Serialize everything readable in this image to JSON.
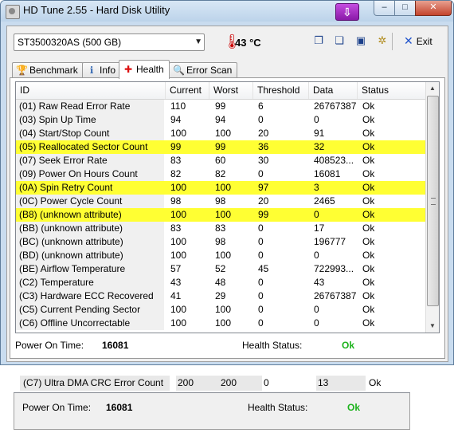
{
  "window": {
    "title": "HD Tune 2.55 - Hard Disk Utility",
    "controls": {
      "minimize": "–",
      "maximize": "□",
      "close": "✕"
    }
  },
  "toolbar": {
    "drive": "ST3500320AS (500 GB)",
    "temperature": "43 °C",
    "exit_label": "Exit"
  },
  "tabs": [
    {
      "label": "Benchmark",
      "icon": "trophy-icon",
      "active": false
    },
    {
      "label": "Info",
      "icon": "info-icon",
      "active": false
    },
    {
      "label": "Health",
      "icon": "health-cross-icon",
      "active": true
    },
    {
      "label": "Error Scan",
      "icon": "magnifier-icon",
      "active": false
    }
  ],
  "table": {
    "columns": [
      "ID",
      "Current",
      "Worst",
      "Threshold",
      "Data",
      "Status"
    ],
    "rows": [
      {
        "id": "(01) Raw Read Error Rate",
        "current": "110",
        "worst": "99",
        "threshold": "6",
        "data": "26767387",
        "status": "Ok",
        "highlight": false
      },
      {
        "id": "(03) Spin Up Time",
        "current": "94",
        "worst": "94",
        "threshold": "0",
        "data": "0",
        "status": "Ok",
        "highlight": false
      },
      {
        "id": "(04) Start/Stop Count",
        "current": "100",
        "worst": "100",
        "threshold": "20",
        "data": "91",
        "status": "Ok",
        "highlight": false
      },
      {
        "id": "(05) Reallocated Sector Count",
        "current": "99",
        "worst": "99",
        "threshold": "36",
        "data": "32",
        "status": "Ok",
        "highlight": true
      },
      {
        "id": "(07) Seek Error Rate",
        "current": "83",
        "worst": "60",
        "threshold": "30",
        "data": "408523...",
        "status": "Ok",
        "highlight": false
      },
      {
        "id": "(09) Power On Hours Count",
        "current": "82",
        "worst": "82",
        "threshold": "0",
        "data": "16081",
        "status": "Ok",
        "highlight": false
      },
      {
        "id": "(0A) Spin Retry Count",
        "current": "100",
        "worst": "100",
        "threshold": "97",
        "data": "3",
        "status": "Ok",
        "highlight": true
      },
      {
        "id": "(0C) Power Cycle Count",
        "current": "98",
        "worst": "98",
        "threshold": "20",
        "data": "2465",
        "status": "Ok",
        "highlight": false
      },
      {
        "id": "(B8) (unknown attribute)",
        "current": "100",
        "worst": "100",
        "threshold": "99",
        "data": "0",
        "status": "Ok",
        "highlight": true
      },
      {
        "id": "(BB) (unknown attribute)",
        "current": "83",
        "worst": "83",
        "threshold": "0",
        "data": "17",
        "status": "Ok",
        "highlight": false
      },
      {
        "id": "(BC) (unknown attribute)",
        "current": "100",
        "worst": "98",
        "threshold": "0",
        "data": "196777",
        "status": "Ok",
        "highlight": false
      },
      {
        "id": "(BD) (unknown attribute)",
        "current": "100",
        "worst": "100",
        "threshold": "0",
        "data": "0",
        "status": "Ok",
        "highlight": false
      },
      {
        "id": "(BE) Airflow Temperature",
        "current": "57",
        "worst": "52",
        "threshold": "45",
        "data": "722993...",
        "status": "Ok",
        "highlight": false
      },
      {
        "id": "(C2) Temperature",
        "current": "43",
        "worst": "48",
        "threshold": "0",
        "data": "43",
        "status": "Ok",
        "highlight": false
      },
      {
        "id": "(C3) Hardware ECC Recovered",
        "current": "41",
        "worst": "29",
        "threshold": "0",
        "data": "26767387",
        "status": "Ok",
        "highlight": false
      },
      {
        "id": "(C5) Current Pending Sector",
        "current": "100",
        "worst": "100",
        "threshold": "0",
        "data": "0",
        "status": "Ok",
        "highlight": false
      },
      {
        "id": "(C6) Offline Uncorrectable",
        "current": "100",
        "worst": "100",
        "threshold": "0",
        "data": "0",
        "status": "Ok",
        "highlight": false
      }
    ]
  },
  "footer": {
    "power_on_label": "Power On Time:",
    "power_on_value": "16081",
    "health_label": "Health Status:",
    "health_value": "Ok"
  },
  "lower_crop": {
    "row": {
      "id": "(C7) Ultra DMA CRC Error Count",
      "current": "200",
      "worst": "200",
      "threshold": "0",
      "data": "13",
      "status": "Ok"
    },
    "power_on_label": "Power On Time:",
    "power_on_value": "16081",
    "health_label": "Health Status:",
    "health_value": "Ok"
  },
  "colors": {
    "highlight": "#ffff33",
    "ok_green": "#1db31d",
    "thermometer": "#cc0000"
  }
}
